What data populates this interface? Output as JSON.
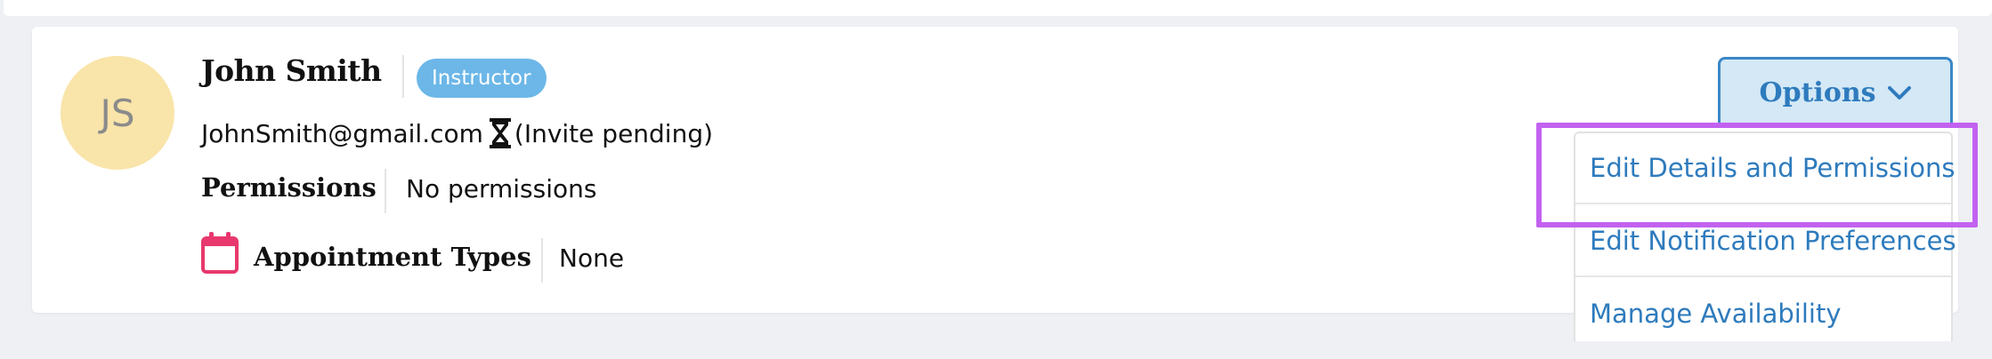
{
  "user": {
    "initials": "JS",
    "name": "John Smith",
    "role_badge": "Instructor",
    "email": "JohnSmith@gmail.com",
    "invite_status": "(Invite pending)",
    "permissions_label": "Permissions",
    "permissions_value": "No permissions",
    "appointment_types_label": "Appointment Types",
    "appointment_types_value": "None"
  },
  "options": {
    "label": "Options",
    "items": [
      {
        "label": "Edit Details and Permissions"
      },
      {
        "label": "Edit Notification Preferences"
      },
      {
        "label": "Manage Availability"
      }
    ]
  },
  "colors": {
    "accent_link": "#2e7bbd",
    "badge": "#6cb7e8",
    "avatar_bg": "#f9e4a9",
    "calendar_icon": "#e8386d",
    "highlight": "#c262f0"
  },
  "icons": [
    "hourglass-icon",
    "calendar-icon",
    "chevron-down-icon"
  ]
}
